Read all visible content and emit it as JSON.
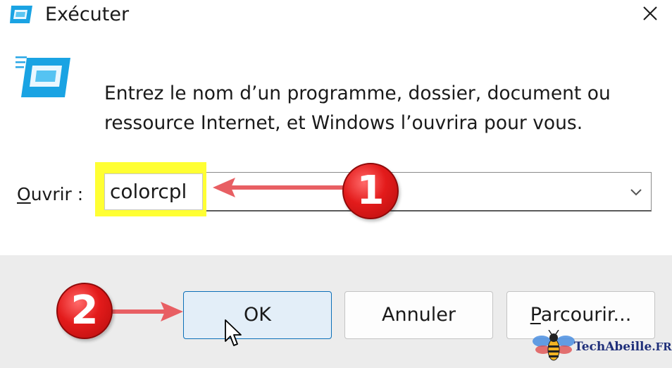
{
  "window": {
    "title": "Exécuter"
  },
  "description": "Entrez le nom d’un programme, dossier, document ou ressource Internet, et Windows l’ouvrira pour vous.",
  "open_field": {
    "label_first": "O",
    "label_rest": "uvrir :",
    "value": "colorcpl"
  },
  "buttons": {
    "ok": "OK",
    "cancel": "Annuler",
    "browse_first": "P",
    "browse_rest": "arcourir..."
  },
  "annotations": {
    "step1": "1",
    "step2": "2"
  },
  "watermark": {
    "name": "TechAbeille",
    "suffix": ".FR"
  },
  "colors": {
    "highlight": "#ffff33",
    "badge": "#e31b1b",
    "ok_border": "#0c6fb8",
    "footer": "#ececec",
    "arrow": "#e85f63"
  },
  "icons": [
    "run-app-icon",
    "close-icon",
    "chevron-down-icon",
    "mouse-pointer-icon",
    "bee-logo-icon"
  ]
}
